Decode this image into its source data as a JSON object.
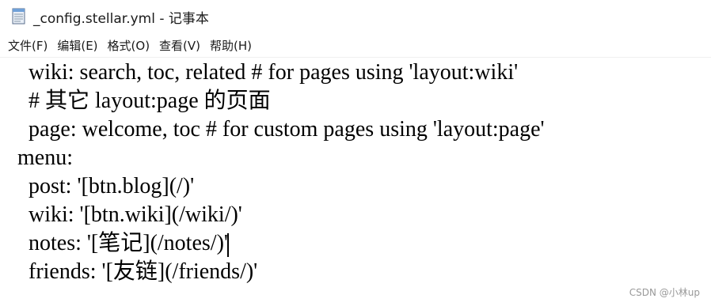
{
  "window": {
    "title": "_config.stellar.yml - 记事本",
    "icon": "notepad-icon"
  },
  "menu": [
    {
      "label": "文件(F)"
    },
    {
      "label": "编辑(E)"
    },
    {
      "label": "格式(O)"
    },
    {
      "label": "查看(V)"
    },
    {
      "label": "帮助(H)"
    }
  ],
  "editor": {
    "lines": [
      "  wiki: search, toc, related # for pages using 'layout:wiki'",
      "  # 其它 layout:page 的页面",
      "  page: welcome, toc # for custom pages using 'layout:page'",
      "menu:",
      "  post: '[btn.blog](/)'",
      "  wiki: '[btn.wiki](/wiki/)'",
      "  notes: '[笔记](/notes/)'",
      "  friends: '[友链](/friends/)'"
    ]
  },
  "watermark": "CSDN @小林up"
}
